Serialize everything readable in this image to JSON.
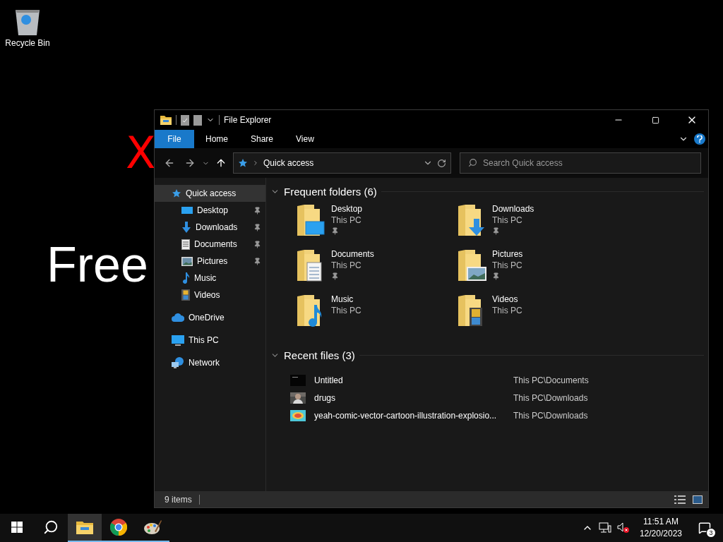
{
  "desktop": {
    "icons": [
      {
        "label": "Recycle Bin"
      }
    ],
    "wallpaper_texts": [
      "X",
      "Free"
    ]
  },
  "window": {
    "title": "File Explorer",
    "ribbon_tabs": [
      {
        "label": "File",
        "selected": true
      },
      {
        "label": "Home",
        "selected": false
      },
      {
        "label": "Share",
        "selected": false
      },
      {
        "label": "View",
        "selected": false
      }
    ],
    "address": {
      "path": "Quick access"
    },
    "search": {
      "placeholder": "Search Quick access"
    },
    "nav_items": [
      {
        "label": "Quick access",
        "kind": "star",
        "selected": true,
        "children": [
          {
            "label": "Desktop",
            "kind": "desktop",
            "selected": false,
            "pinned": true
          },
          {
            "label": "Downloads",
            "kind": "download",
            "selected": false,
            "pinned": true
          },
          {
            "label": "Documents",
            "kind": "document",
            "selected": false,
            "pinned": true
          },
          {
            "label": "Pictures",
            "kind": "picture",
            "selected": false,
            "pinned": true
          },
          {
            "label": "Music",
            "kind": "music",
            "selected": false,
            "pinned": false
          },
          {
            "label": "Videos",
            "kind": "video",
            "selected": false,
            "pinned": false
          }
        ]
      },
      {
        "label": "OneDrive",
        "kind": "cloud",
        "selected": false
      },
      {
        "label": "This PC",
        "kind": "pc",
        "selected": false
      },
      {
        "label": "Network",
        "kind": "network",
        "selected": false
      }
    ],
    "sections": [
      {
        "title": "Frequent folders (6)",
        "kind": "folders",
        "expanded": true,
        "items": [
          {
            "name": "Desktop",
            "location": "This PC",
            "kind": "desktop",
            "pinned": true
          },
          {
            "name": "Downloads",
            "location": "This PC",
            "kind": "download",
            "pinned": true
          },
          {
            "name": "Documents",
            "location": "This PC",
            "kind": "document",
            "pinned": true
          },
          {
            "name": "Pictures",
            "location": "This PC",
            "kind": "picture",
            "pinned": true
          },
          {
            "name": "Music",
            "location": "This PC",
            "kind": "music",
            "pinned": false
          },
          {
            "name": "Videos",
            "location": "This PC",
            "kind": "video",
            "pinned": false
          }
        ]
      },
      {
        "title": "Recent files (3)",
        "kind": "files",
        "expanded": true,
        "items": [
          {
            "name": "Untitled",
            "location": "This PC\\Documents"
          },
          {
            "name": "drugs",
            "location": "This PC\\Downloads"
          },
          {
            "name": "yeah-comic-vector-cartoon-illustration-explosio...",
            "location": "This PC\\Downloads"
          }
        ]
      }
    ],
    "status_bar": {
      "item_count": "9 items"
    }
  },
  "taskbar": {
    "apps": [
      {
        "kind": "explorer",
        "selected": true
      },
      {
        "kind": "chrome",
        "selected": false
      },
      {
        "kind": "paint",
        "selected": false
      }
    ],
    "time": "11:51 AM",
    "date": "12/20/2023",
    "notification_count": "3"
  }
}
